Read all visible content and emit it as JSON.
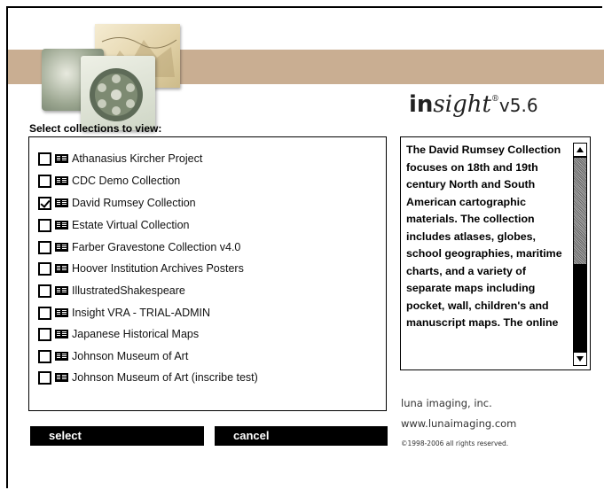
{
  "app": {
    "logo_bold": "in",
    "logo_italic": "sight",
    "logo_reg": "®",
    "logo_version": "v5.6"
  },
  "collections": {
    "heading": "Select collections to view:",
    "items": [
      {
        "label": "Athanasius Kircher Project",
        "checked": false
      },
      {
        "label": "CDC Demo Collection",
        "checked": false
      },
      {
        "label": "David Rumsey Collection",
        "checked": true
      },
      {
        "label": "Estate Virtual Collection",
        "checked": false
      },
      {
        "label": "Farber Gravestone Collection v4.0",
        "checked": false
      },
      {
        "label": "Hoover Institution Archives Posters",
        "checked": false
      },
      {
        "label": "IllustratedShakespeare",
        "checked": false
      },
      {
        "label": "Insight VRA - TRIAL-ADMIN",
        "checked": false
      },
      {
        "label": "Japanese Historical Maps",
        "checked": false
      },
      {
        "label": "Johnson Museum of Art",
        "checked": false
      },
      {
        "label": "Johnson Museum of Art (inscribe test)",
        "checked": false
      }
    ],
    "item_icon": "collection-icon"
  },
  "description": {
    "text": "The David Rumsey Collection focuses on 18th and 19th century North and South American cartographic materials. The collection includes atlases, globes, school geographies, maritime charts, and a variety of separate maps including pocket, wall, children's and manuscript maps. The online"
  },
  "buttons": {
    "select": "select",
    "cancel": "cancel"
  },
  "company": {
    "name": "luna imaging, inc.",
    "url": "www.lunaimaging.com",
    "copyright": "©1998-2006 all rights reserved."
  },
  "colors": {
    "banner": "#c9ae92",
    "button_bg": "#000000",
    "button_text": "#ffffff"
  }
}
